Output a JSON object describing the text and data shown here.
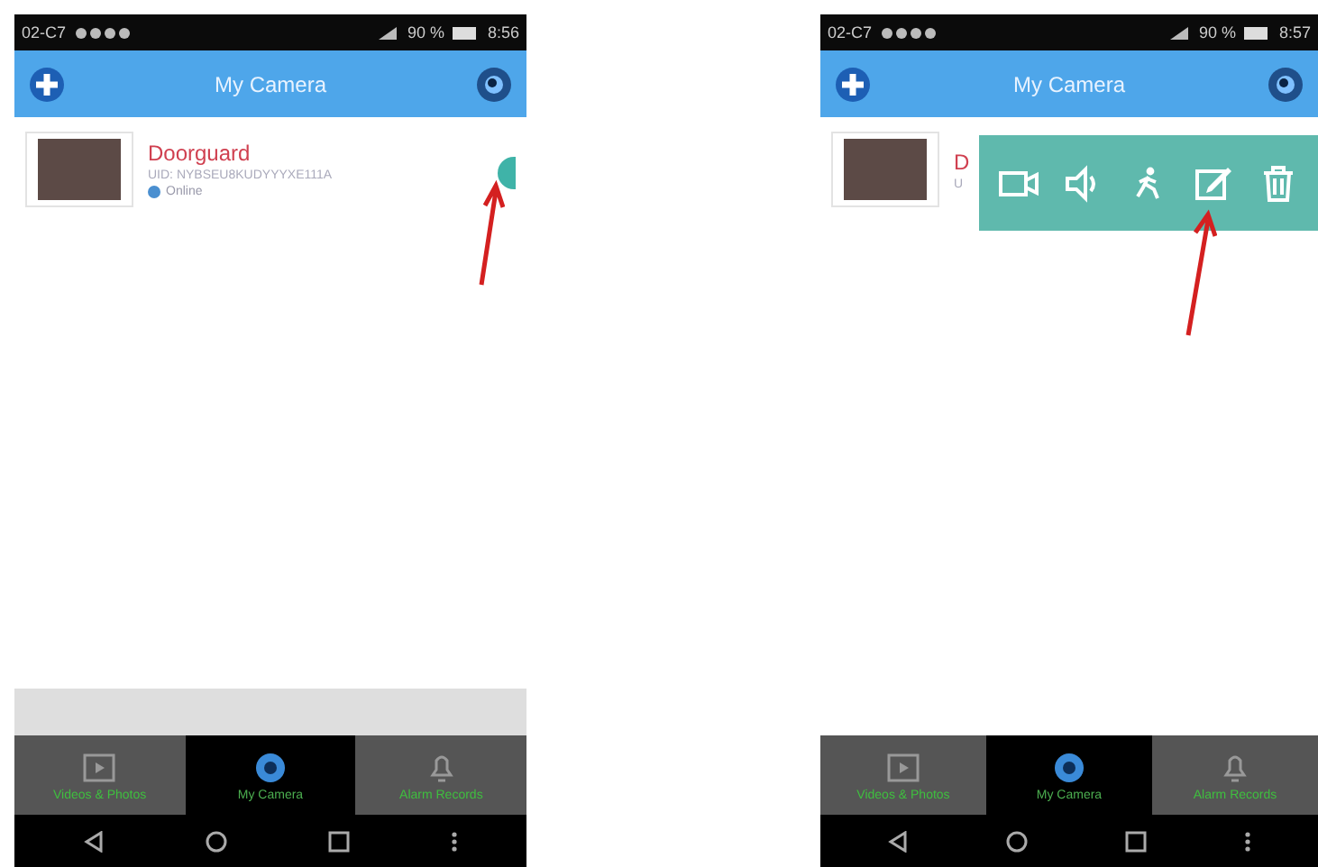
{
  "screens": [
    {
      "status_bar": {
        "carrier": "02-C7",
        "battery": "90 %",
        "time": "8:56"
      },
      "header": {
        "title": "My Camera"
      },
      "cameras": [
        {
          "name": "Doorguard",
          "uid": "UID: NYBSEU8KUDYYYXE111A",
          "status": "Online"
        }
      ],
      "menu_open": false,
      "tabs": [
        {
          "label": "Videos & Photos",
          "kind": "videos",
          "selected": false
        },
        {
          "label": "My Camera",
          "kind": "camera",
          "selected": true
        },
        {
          "label": "Alarm Records",
          "kind": "alarm",
          "selected": false
        }
      ]
    },
    {
      "status_bar": {
        "carrier": "02-C7",
        "battery": "90 %",
        "time": "8:57"
      },
      "header": {
        "title": "My Camera"
      },
      "cameras": [
        {
          "name": "D",
          "uid": "U"
        }
      ],
      "menu_open": true,
      "actions": [
        {
          "kind": "video"
        },
        {
          "kind": "speaker"
        },
        {
          "kind": "motion"
        },
        {
          "kind": "edit"
        },
        {
          "kind": "delete"
        }
      ],
      "tabs": [
        {
          "label": "Videos & Photos",
          "kind": "videos",
          "selected": false
        },
        {
          "label": "My Camera",
          "kind": "camera",
          "selected": true
        },
        {
          "label": "Alarm Records",
          "kind": "alarm",
          "selected": false
        }
      ]
    }
  ]
}
